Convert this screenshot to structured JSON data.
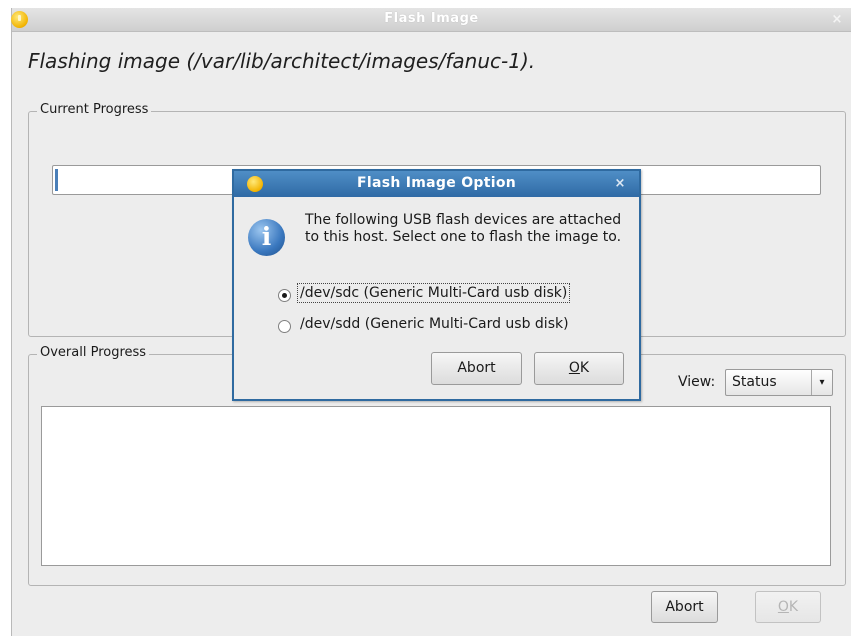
{
  "window": {
    "title": "Flash Image",
    "close_glyph": "×",
    "heading": "Flashing image (/var/lib/architect/images/fanuc-1).",
    "current_progress": {
      "label": "Current Progress",
      "value_fraction": 0.0
    },
    "overall_progress": {
      "label": "Overall Progress",
      "view_label": "View:",
      "view_selected": "Status"
    },
    "buttons": {
      "abort": "Abort",
      "ok_mnemonic": "O",
      "ok_rest": "K",
      "ok_enabled": false
    }
  },
  "dialog": {
    "title": "Flash Image Option",
    "close_glyph": "×",
    "message": "The following USB flash devices are attached to this host.  Select one to flash the image to.",
    "options": [
      {
        "label": "/dev/sdc (Generic Multi-Card usb disk)",
        "selected": true
      },
      {
        "label": "/dev/sdd (Generic Multi-Card usb disk)",
        "selected": false
      }
    ],
    "buttons": {
      "abort": "Abort",
      "ok_mnemonic": "O",
      "ok_rest": "K"
    },
    "info_icon_glyph": "i"
  },
  "icons": {
    "window_icon": "warning-bulb-icon",
    "dialog_icon": "warning-bulb-icon",
    "info_icon": "info-icon",
    "dropdown_arrow": "▾"
  },
  "colors": {
    "dialog_titlebar": "#2f6aa5",
    "progress_fill": "#4a7fb8"
  }
}
